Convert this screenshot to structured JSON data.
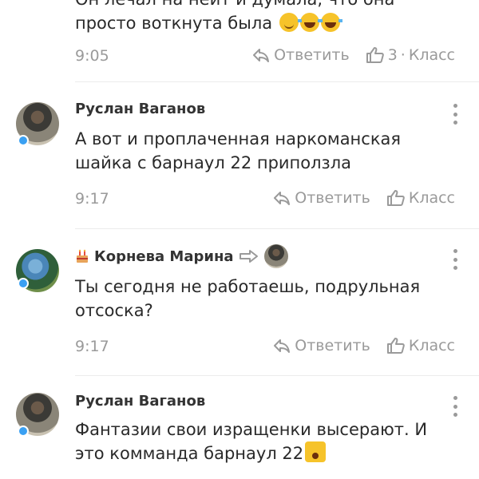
{
  "comments": [
    {
      "author": "",
      "text_lines": [
        "",
        "просто воткнута была"
      ],
      "text_partial_top": "Он лечал на нейт и думала, что она",
      "emojis": [
        "winking-face",
        "face-with-tears-of-joy",
        "face-with-tears-of-joy"
      ],
      "time": "9:05",
      "reply_label": "Ответить",
      "like_count": "3",
      "like_separator": "·",
      "like_label": "Класс"
    },
    {
      "author": "Руслан Ваганов",
      "text": "А вот и проплаченная наркоманская шайка с барнаул 22 приползла",
      "time": "9:17",
      "reply_label": "Ответить",
      "like_label": "Класс"
    },
    {
      "author": "Корнева Марина",
      "author_badge_icon": "birthday-cake",
      "reply_to_icon": "reply-arrow",
      "text": "Ты сегодня не работаешь, подрульная отсоска?",
      "time": "9:17",
      "reply_label": "Ответить",
      "like_label": "Класс"
    },
    {
      "author": "Руслан Ваганов",
      "text": "Фантазии свои изращенки высерают. И это комманда барнаул 22",
      "text_emoji": "fearful-face",
      "time": "",
      "reply_label": "",
      "like_label": ""
    }
  ],
  "colors": {
    "online_dot": "#3aa0f2",
    "meta_gray": "#9a9a9a",
    "text": "#2a2a2a"
  }
}
